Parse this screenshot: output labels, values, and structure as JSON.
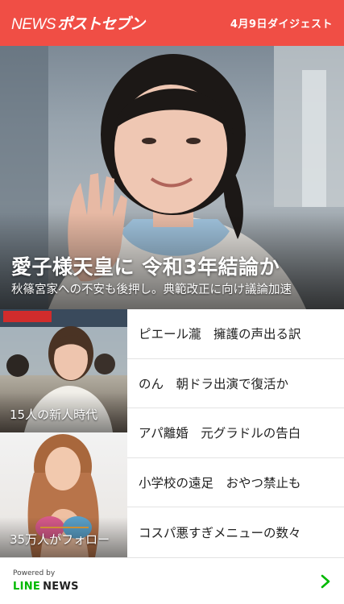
{
  "header": {
    "logo_news": "NEWS",
    "logo_brand": "ポストセブン",
    "digest_label": "4月9日ダイジェスト",
    "bg_color": "#f04e45"
  },
  "hero": {
    "title": "愛子様天皇に 令和3年結論か",
    "subtitle": "秋篠宮家への不安も後押し。典範改正に向け議論加速"
  },
  "thumbnails": [
    {
      "caption": "15人の新人時代"
    },
    {
      "caption": "35万人がフォロー"
    }
  ],
  "articles": [
    {
      "title": "ピエール瀧　擁護の声出る訳"
    },
    {
      "title": "のん　朝ドラ出演で復活か"
    },
    {
      "title": "アパ離婚　元グラドルの告白"
    },
    {
      "title": "小学校の遠足　おやつ禁止も"
    },
    {
      "title": "コスパ悪すぎメニューの数々"
    }
  ],
  "footer": {
    "powered_by": "Powered by",
    "line": "LINE",
    "news": "NEWS",
    "chevron_icon": "chevron-right-icon",
    "accent_color": "#00b900"
  }
}
